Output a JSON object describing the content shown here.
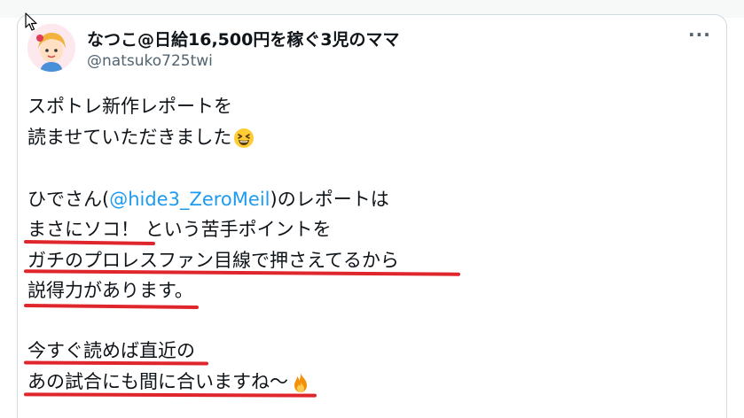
{
  "author": {
    "display_name": "なつこ@日給16,500円を稼ぐ3児のママ",
    "handle": "@natsuko725twi"
  },
  "more_label": "···",
  "tweet": {
    "line1": "スポトレ新作レポートを",
    "line2": "読ませていただきました",
    "line3_pre": "ひでさん(",
    "line3_mention": "@hide3_ZeroMeil",
    "line3_post": ")のレポートは",
    "line4": "まさにソコ！ という苦手ポイントを",
    "line5": "ガチのプロレスファン目線で押さえてるから",
    "line6": "説得力があります。",
    "line7": "今すぐ読めば直近の",
    "line8": "あの試合にも間に合いますね～"
  },
  "colors": {
    "underline": "#e0262d",
    "mention": "#1d9bf0",
    "handle": "#536471"
  },
  "icons": [
    "cursor-icon",
    "avatar",
    "more-icon",
    "grinning-squinting-face-icon",
    "fire-icon"
  ]
}
